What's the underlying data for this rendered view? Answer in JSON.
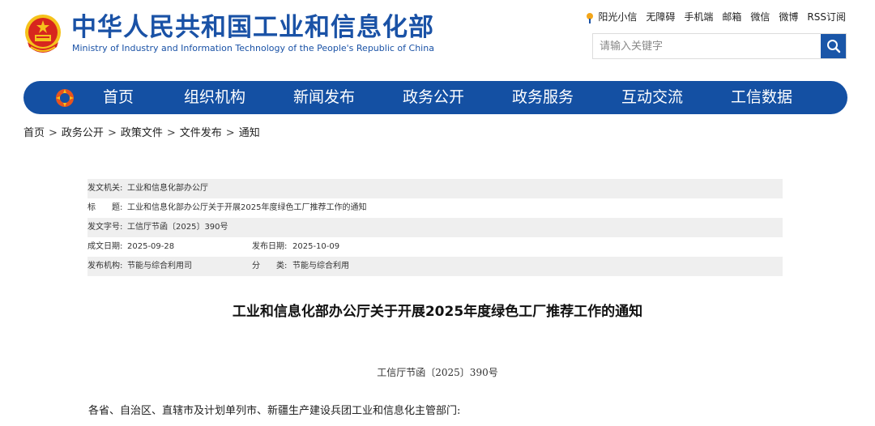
{
  "header": {
    "title_cn": "中华人民共和国工业和信息化部",
    "title_en": "Ministry of Industry and Information Technology of the People's Republic of China",
    "emblem_icon": "national-emblem-icon"
  },
  "toplinks": [
    "阳光小信",
    "无障碍",
    "手机端",
    "邮箱",
    "微信",
    "微博",
    "RSS订阅"
  ],
  "search": {
    "placeholder": "请输入关键字",
    "button_icon": "search-icon"
  },
  "nav": {
    "logo_icon": "miit-logo-icon",
    "items": [
      "首页",
      "组织机构",
      "新闻发布",
      "政务公开",
      "政务服务",
      "互动交流",
      "工信数据"
    ]
  },
  "breadcrumb": [
    "首页",
    "政务公开",
    "政策文件",
    "文件发布",
    "通知"
  ],
  "meta": {
    "issuer_label": "发文机关:",
    "issuer": "工业和信息化部办公厅",
    "title_label": "标　　题:",
    "title": "工业和信息化部办公厅关于开展2025年度绿色工厂推荐工作的通知",
    "docno_label": "发文字号:",
    "docno": "工信厅节函〔2025〕390号",
    "created_label": "成文日期:",
    "created": "2025-09-28",
    "published_label": "发布日期:",
    "published": "2025-10-09",
    "publisher_label": "发布机构:",
    "publisher": "节能与综合利用司",
    "category_label": "分　　类:",
    "category": "节能与综合利用"
  },
  "document": {
    "title": "工业和信息化部办公厅关于开展2025年度绿色工厂推荐工作的通知",
    "number": "工信厅节函〔2025〕390号",
    "addressee": "各省、自治区、直辖市及计划单列市、新疆生产建设兵团工业和信息化主管部门:"
  },
  "colors": {
    "brand_blue": "#1450a3",
    "emblem_red": "#d7261e",
    "emblem_gold": "#f5c21b"
  }
}
